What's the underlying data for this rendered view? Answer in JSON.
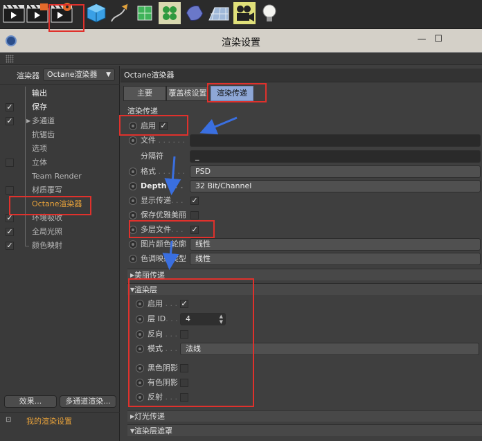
{
  "window": {
    "title": "渲染设置",
    "minimize": "—",
    "maximize": "☐"
  },
  "toolbar": {
    "icons": [
      "render-view-clapper-icon",
      "render-picture-viewer-clapper-icon",
      "render-settings-clapper-icon",
      "cube-primitive-icon",
      "pen-spline-icon",
      "subdivision-surface-icon",
      "mograph-cloner-icon",
      "deformer-icon",
      "floor-scene-icon",
      "camera-icon",
      "light-bulb-icon"
    ]
  },
  "left_panel": {
    "renderer_label": "渲染器",
    "renderer_value": "Octane渲染器",
    "items": [
      {
        "label": "输出",
        "checked": null
      },
      {
        "label": "保存",
        "checked": true
      },
      {
        "label": "多通道",
        "checked": true
      },
      {
        "label": "抗锯齿",
        "checked": null
      },
      {
        "label": "选项",
        "checked": null
      },
      {
        "label": "立体",
        "checked": false
      },
      {
        "label": "Team Render",
        "checked": null
      },
      {
        "label": "材质覆写",
        "checked": false
      },
      {
        "label": "Octane渲染器",
        "checked": null
      },
      {
        "label": "环境吸收",
        "checked": true
      },
      {
        "label": "全局光照",
        "checked": true
      },
      {
        "label": "颜色映射",
        "checked": true
      }
    ],
    "effects_button": "效果...",
    "multipass_button": "多通道渲染...",
    "preset_label": "我的渲染设置"
  },
  "right_panel": {
    "header": "Octane渲染器",
    "tabs": [
      "主要",
      "覆盖核设置",
      "渲染传递"
    ],
    "section_title": "渲染传递",
    "enable_label": "启用",
    "enable_checked": true,
    "file_label": "文件",
    "file_value": "",
    "separator_label": "分隔符",
    "separator_value": "_",
    "format_label": "格式",
    "format_value": "PSD",
    "depth_label": "Depth",
    "depth_value": "32 Bit/Channel",
    "show_passes_label": "显示传递",
    "show_passes_checked": true,
    "keep_beauty_label": "保存优雅美丽",
    "keep_beauty_checked": false,
    "multilayer_label": "多层文件",
    "multilayer_checked": true,
    "color_profile_label": "图片颜色轮廓",
    "color_profile_value": "线性",
    "tonemap_label": "色调映射类型",
    "tonemap_value": "线性",
    "beauty_passes": "美丽传递",
    "render_layer": {
      "title": "渲染层",
      "enable_label": "启用",
      "enable_checked": true,
      "layer_id_label": "层 ID",
      "layer_id_value": "4",
      "invert_label": "反向",
      "invert_checked": false,
      "mode_label": "模式",
      "mode_value": "法线",
      "black_shadow_label": "黑色阴影",
      "black_shadow_checked": false,
      "color_shadow_label": "有色阴影",
      "color_shadow_checked": false,
      "reflection_label": "反射",
      "reflection_checked": false
    },
    "light_passes": "灯光传递",
    "render_layer_mask": "渲染层遮罩"
  },
  "colors": {
    "highlight_red": "#e0312c",
    "arrow_blue": "#3a6fe0",
    "orange_text": "#e8a23a",
    "active_tab": "#8ea7d6"
  }
}
